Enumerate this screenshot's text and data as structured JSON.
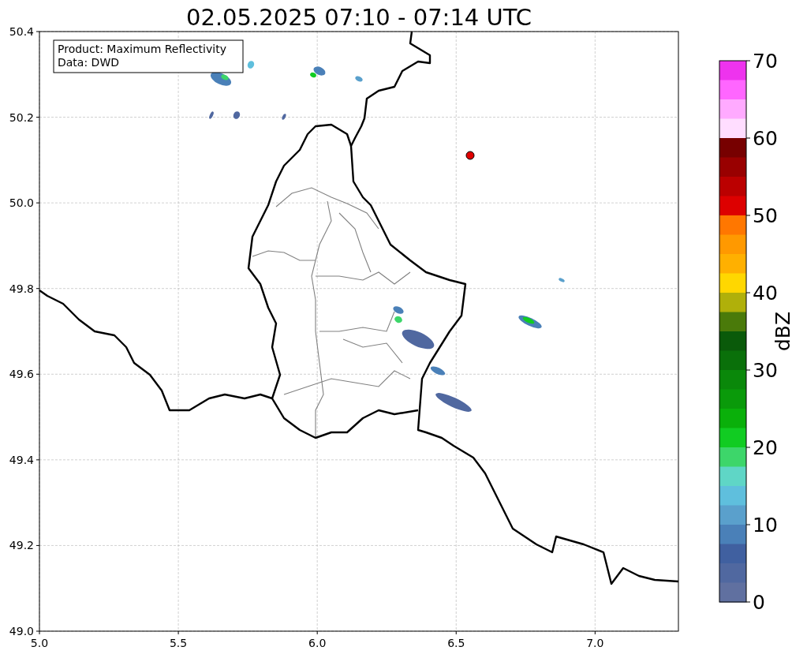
{
  "title": "02.05.2025 07:10 - 07:14 UTC",
  "map": {
    "legend": [
      "Product: Maximum Reflectivity",
      "Data: DWD"
    ],
    "y_ticks": [
      "50.4",
      "50.2",
      "50.0",
      "49.8",
      "49.6",
      "49.4",
      "49.2",
      "49.0"
    ],
    "x_ticks": [
      "5.0",
      "5.5",
      "6.0",
      "6.5",
      "7.0"
    ]
  },
  "colorbar": {
    "label": "dBZ",
    "ticks": [
      "70",
      "60",
      "50",
      "40",
      "30",
      "20",
      "10",
      "0"
    ],
    "bands": [
      {
        "color": "#ee33ee"
      },
      {
        "color": "#ff66ff"
      },
      {
        "color": "#ffaaff"
      },
      {
        "color": "#ffddff"
      },
      {
        "color": "#770000"
      },
      {
        "color": "#990000"
      },
      {
        "color": "#bb0000"
      },
      {
        "color": "#dd0000"
      },
      {
        "color": "#ff7700"
      },
      {
        "color": "#ff9900"
      },
      {
        "color": "#ffb000"
      },
      {
        "color": "#ffd700"
      },
      {
        "color": "#b0b00a"
      },
      {
        "color": "#4a7a0a"
      },
      {
        "color": "#0a5a0a"
      },
      {
        "color": "#0a700a"
      },
      {
        "color": "#0a880a"
      },
      {
        "color": "#0a9a0a"
      },
      {
        "color": "#0ab00a"
      },
      {
        "color": "#11cc22"
      },
      {
        "color": "#3dd66a"
      },
      {
        "color": "#5fd6c6"
      },
      {
        "color": "#5fbfdd"
      },
      {
        "color": "#5aa0cc"
      },
      {
        "color": "#4a80b8"
      },
      {
        "color": "#4060a0"
      },
      {
        "color": "#5068a0"
      },
      {
        "color": "#6070a0"
      }
    ]
  }
}
